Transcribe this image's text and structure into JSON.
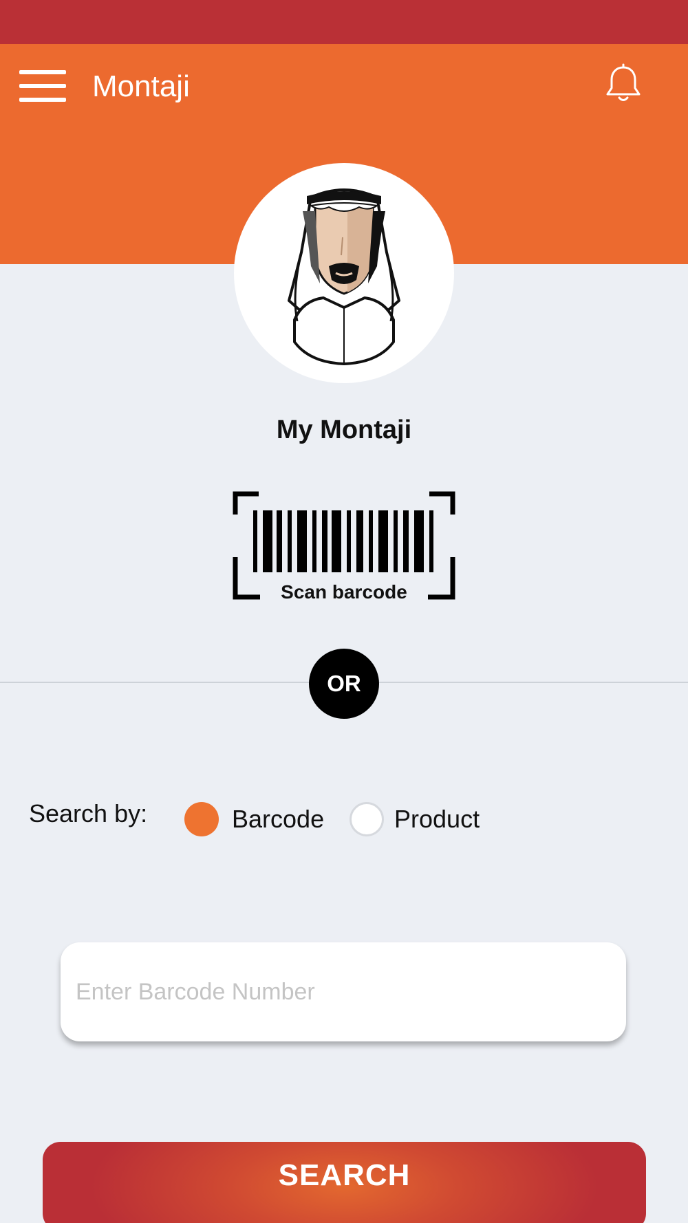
{
  "app": {
    "title": "Montaji"
  },
  "header": {
    "menu_icon": "hamburger-menu-icon",
    "notification_icon": "bell-icon"
  },
  "profile": {
    "avatar_icon": "user-avatar",
    "name": "My Montaji"
  },
  "scan": {
    "icon": "barcode-scan-icon",
    "label": "Scan barcode"
  },
  "separator": {
    "label": "OR"
  },
  "search_by": {
    "label": "Search by:",
    "options": [
      {
        "label": "Barcode",
        "selected": true
      },
      {
        "label": "Product",
        "selected": false
      }
    ]
  },
  "input": {
    "value": "",
    "placeholder": "Enter Barcode Number"
  },
  "search_button": {
    "label": "SEARCH"
  },
  "colors": {
    "primary": "#EC6A2F",
    "status_bar": "#BA3036",
    "background": "#ECEFF4",
    "radio_selected": "#EE7330"
  }
}
